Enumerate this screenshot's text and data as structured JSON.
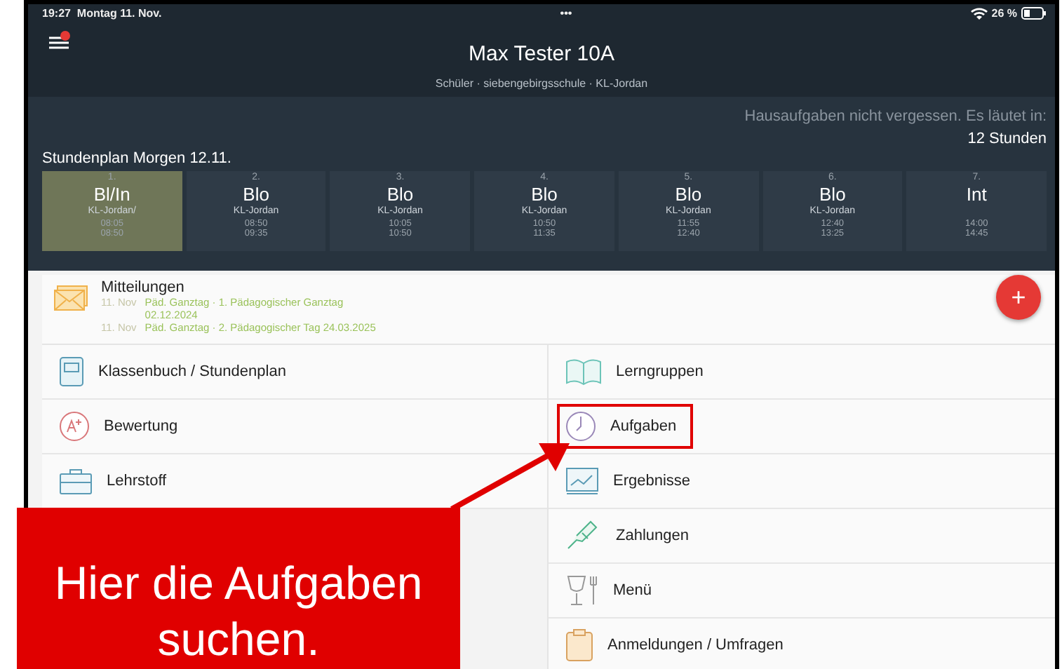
{
  "status_bar": {
    "time": "19:27",
    "date": "Montag 11. Nov.",
    "dots": "•••",
    "battery": "26 %"
  },
  "header": {
    "title": "Max Tester 10A",
    "subtitle": "Schüler · siebengebirgsschule · KL-Jordan",
    "has_notification": true
  },
  "reminder": {
    "text": "Hausaufgaben nicht vergessen. Es läutet in:",
    "countdown": "12 Stunden"
  },
  "timetable": {
    "title": "Stundenplan Morgen 12.11.",
    "lessons": [
      {
        "number": "1.",
        "subject": "Bl/In",
        "teacher": "KL-Jordan/",
        "start": "08:05",
        "end": "08:50",
        "selected": true
      },
      {
        "number": "2.",
        "subject": "Blo",
        "teacher": "KL-Jordan",
        "start": "08:50",
        "end": "09:35",
        "selected": false
      },
      {
        "number": "3.",
        "subject": "Blo",
        "teacher": "KL-Jordan",
        "start": "10:05",
        "end": "10:50",
        "selected": false
      },
      {
        "number": "4.",
        "subject": "Blo",
        "teacher": "KL-Jordan",
        "start": "10:50",
        "end": "11:35",
        "selected": false
      },
      {
        "number": "5.",
        "subject": "Blo",
        "teacher": "KL-Jordan",
        "start": "11:55",
        "end": "12:40",
        "selected": false
      },
      {
        "number": "6.",
        "subject": "Blo",
        "teacher": "KL-Jordan",
        "start": "12:40",
        "end": "13:25",
        "selected": false
      },
      {
        "number": "7.",
        "subject": "Int",
        "start": "14:00",
        "end": "14:45",
        "selected": false
      }
    ]
  },
  "add_button": {
    "label": "+"
  },
  "messages": {
    "title": "Mitteilungen",
    "items": [
      {
        "date": "11. Nov",
        "text": "Päd. Ganztag · 1. Pädagogischer Ganztag 02.12.2024"
      },
      {
        "date": "11. Nov",
        "text": "Päd. Ganztag · 2. Pädagogischer Tag 24.03.2025"
      }
    ]
  },
  "menu_left": [
    {
      "kind": "notebook",
      "label": "Klassenbuch / Stundenplan",
      "highlighted": false
    },
    {
      "kind": "grade",
      "label": "Bewertung",
      "highlighted": false
    },
    {
      "kind": "briefcase",
      "label": "Lehrstoff",
      "highlighted": false
    }
  ],
  "menu_right": [
    {
      "kind": "book",
      "label": "Lerngruppen",
      "highlighted": false
    },
    {
      "kind": "clock",
      "label": "Aufgaben",
      "highlighted": true
    },
    {
      "kind": "chart",
      "label": "Ergebnisse",
      "highlighted": false
    },
    {
      "kind": "money",
      "label": "Zahlungen",
      "highlighted": false
    },
    {
      "kind": "dining",
      "label": "Menü",
      "highlighted": false
    },
    {
      "kind": "clipboard",
      "label": "Anmeldungen / Umfragen",
      "highlighted": false
    }
  ],
  "callout": {
    "text": "Hier die Aufgaben suchen."
  }
}
